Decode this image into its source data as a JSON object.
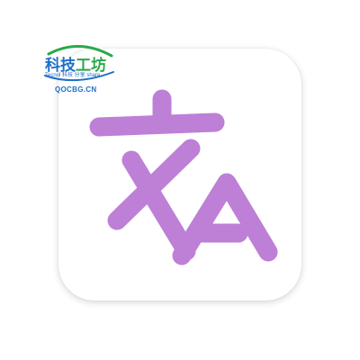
{
  "app_icon": {
    "icon": "translate-icon",
    "background_color": "#ffffff",
    "glyph_color": "#be7fd6"
  },
  "watermark": {
    "title_part1": "科技",
    "title_part2": "工坊",
    "subtitle": "Tecnol 科技 分享 share",
    "domain": "QOCBG.CN",
    "colors": {
      "blue": "#1e6fc8",
      "green": "#2aa84a"
    }
  }
}
